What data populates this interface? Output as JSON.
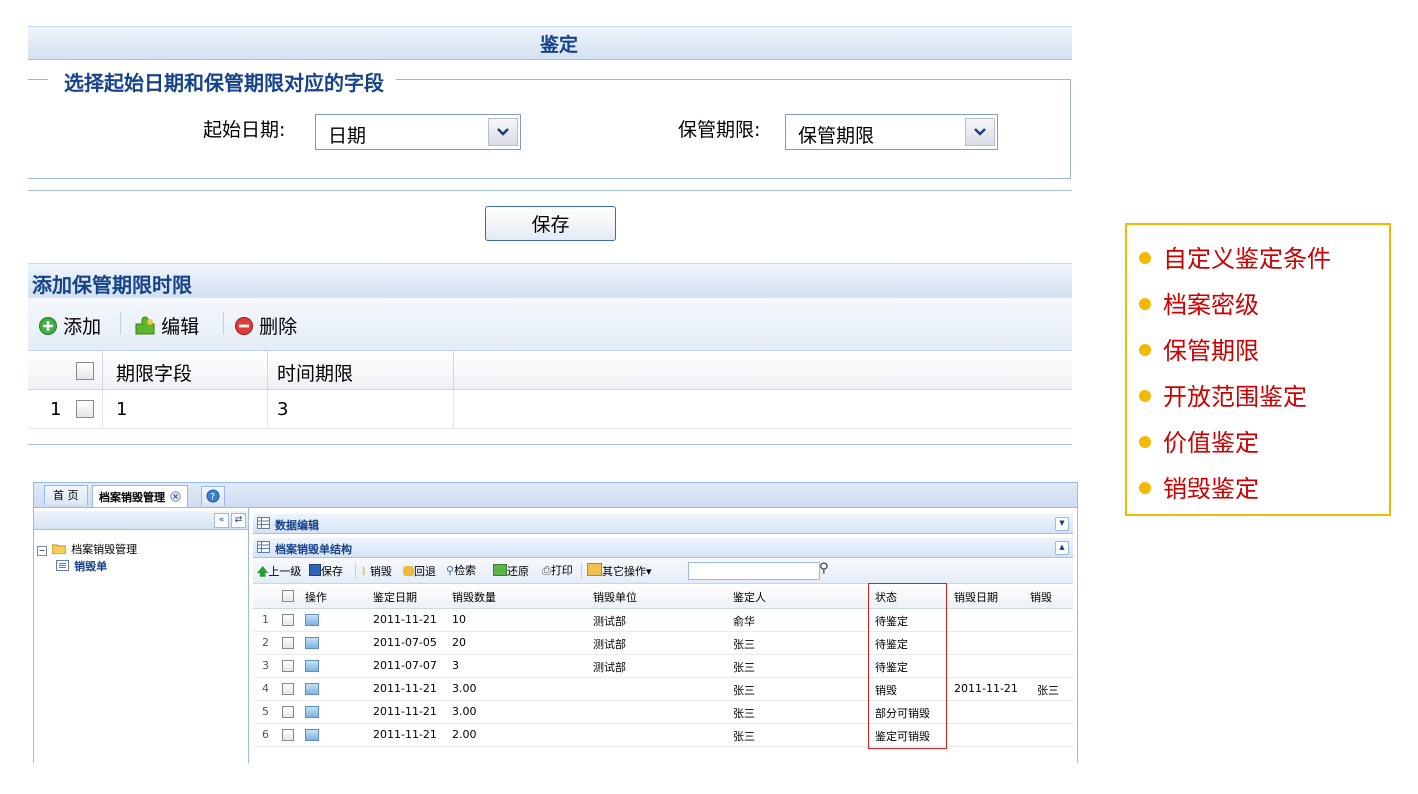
{
  "top_panel": {
    "title": "鉴定",
    "fieldset_legend": "选择起始日期和保管期限对应的字段",
    "start_date_label": "起始日期:",
    "start_date_value": "日期",
    "retention_label": "保管期限:",
    "retention_value": "保管期限",
    "save_button": "保存"
  },
  "retention_panel": {
    "title": "添加保管期限时限",
    "toolbar": {
      "add": "添加",
      "edit": "编辑",
      "delete": "删除"
    },
    "columns": [
      "期限字段",
      "时间期限"
    ],
    "rows": [
      {
        "num": "1",
        "field": "1",
        "period": "3"
      }
    ]
  },
  "app_window": {
    "tabs": {
      "home": "首 页",
      "active": "档案销毁管理"
    },
    "tree": {
      "root": "档案销毁管理",
      "child": "销毁单"
    },
    "panel1_title": "数据编辑",
    "panel2_title": "档案销毁单结构",
    "toolbar": {
      "up": "上一级",
      "save": "保存",
      "destroy": "销毁",
      "rollback": "回退",
      "search": "检索",
      "restore": "还原",
      "print": "打印",
      "other": "其它操作"
    },
    "columns": [
      "操作",
      "鉴定日期",
      "销毁数量",
      "销毁单位",
      "鉴定人",
      "状态",
      "销毁日期",
      "销毁"
    ],
    "rows": [
      {
        "num": "1",
        "date": "2011-11-21",
        "qty": "10",
        "unit": "测试部",
        "person": "俞华",
        "status": "待鉴定",
        "ddate": "",
        "by": ""
      },
      {
        "num": "2",
        "date": "2011-07-05",
        "qty": "20",
        "unit": "测试部",
        "person": "张三",
        "status": "待鉴定",
        "ddate": "",
        "by": ""
      },
      {
        "num": "3",
        "date": "2011-07-07",
        "qty": "3",
        "unit": "测试部",
        "person": "张三",
        "status": "待鉴定",
        "ddate": "",
        "by": ""
      },
      {
        "num": "4",
        "date": "2011-11-21",
        "qty": "3.00",
        "unit": "",
        "person": "张三",
        "status": "销毁",
        "ddate": "2011-11-21",
        "by": "张三"
      },
      {
        "num": "5",
        "date": "2011-11-21",
        "qty": "3.00",
        "unit": "",
        "person": "张三",
        "status": "部分可销毁",
        "ddate": "",
        "by": ""
      },
      {
        "num": "6",
        "date": "2011-11-21",
        "qty": "2.00",
        "unit": "",
        "person": "张三",
        "status": "鉴定可销毁",
        "ddate": "",
        "by": ""
      }
    ]
  },
  "callout": {
    "items": [
      "自定义鉴定条件",
      "档案密级",
      "保管期限",
      "开放范围鉴定",
      "价值鉴定",
      "销毁鉴定"
    ],
    "bullet_color": "#f5b800",
    "text_color": "#cc0000",
    "border_color": "#f5b800"
  },
  "colors": {
    "highlight_border": "#e02020",
    "header_text": "#15428b"
  }
}
